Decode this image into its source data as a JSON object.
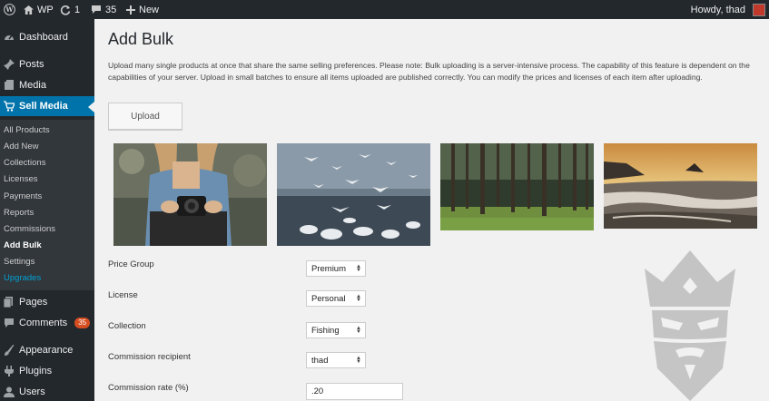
{
  "adminbar": {
    "site_name": "WP",
    "updates_count": "1",
    "comments_count": "35",
    "new_label": "New",
    "greeting": "Howdy, thad"
  },
  "sidebar": {
    "dashboard": "Dashboard",
    "posts": "Posts",
    "media": "Media",
    "sell_media": "Sell Media",
    "submenu": [
      "All Products",
      "Add New",
      "Collections",
      "Licenses",
      "Payments",
      "Reports",
      "Commissions",
      "Add Bulk",
      "Settings",
      "Upgrades"
    ],
    "pages": "Pages",
    "comments": "Comments",
    "comments_badge": "35",
    "appearance": "Appearance",
    "plugins": "Plugins",
    "users": "Users"
  },
  "main": {
    "title": "Add Bulk",
    "description": "Upload many single products at once that share the same selling preferences. Please note: Bulk uploading is a server-intensive process. The capability of this feature is dependent on the capabilities of your server. Upload in small batches to ensure all items uploaded are published correctly. You can modify the prices and licenses of each item after uploading.",
    "upload_label": "Upload"
  },
  "form": {
    "price_group": {
      "label": "Price Group",
      "value": "Premium"
    },
    "license": {
      "label": "License",
      "value": "Personal"
    },
    "collection": {
      "label": "Collection",
      "value": "Fishing"
    },
    "commission_recipient": {
      "label": "Commission recipient",
      "value": "thad"
    },
    "commission_rate": {
      "label": "Commission rate (%)",
      "value": ".20"
    }
  },
  "colors": {
    "adminbar_bg": "#23282d",
    "sidebar_active": "#0073aa",
    "submenu_bg": "#32373c",
    "badge": "#d54e21",
    "link": "#00a0d2"
  }
}
